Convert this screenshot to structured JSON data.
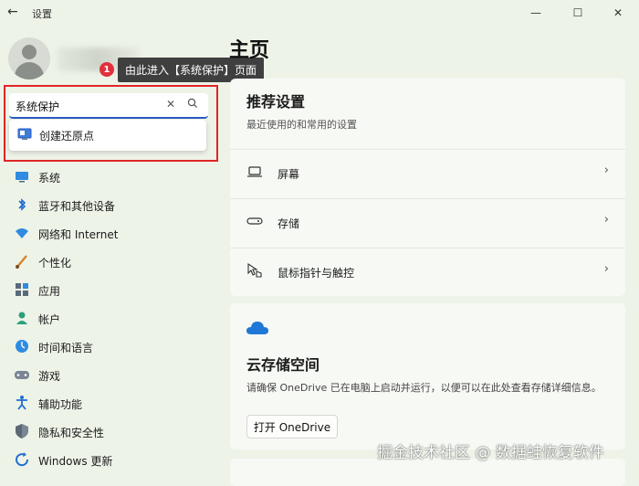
{
  "app": {
    "title": "设置"
  },
  "window_controls": {
    "minimize": "—",
    "maximize": "☐",
    "close": "✕"
  },
  "annotation": {
    "step": "1",
    "text": "由此进入【系统保护】页面"
  },
  "search": {
    "value": "系统保护",
    "clear": "✕",
    "suggestion": "创建还原点"
  },
  "sidebar": {
    "items": [
      {
        "label": "系统",
        "icon": "monitor-icon"
      },
      {
        "label": "蓝牙和其他设备",
        "icon": "bluetooth-icon"
      },
      {
        "label": "网络和 Internet",
        "icon": "wifi-icon"
      },
      {
        "label": "个性化",
        "icon": "brush-icon"
      },
      {
        "label": "应用",
        "icon": "apps-icon"
      },
      {
        "label": "帐户",
        "icon": "account-icon"
      },
      {
        "label": "时间和语言",
        "icon": "globe-clock-icon"
      },
      {
        "label": "游戏",
        "icon": "gamepad-icon"
      },
      {
        "label": "辅助功能",
        "icon": "accessibility-icon"
      },
      {
        "label": "隐私和安全性",
        "icon": "shield-icon"
      },
      {
        "label": "Windows 更新",
        "icon": "update-icon"
      }
    ]
  },
  "main": {
    "title": "主页",
    "recommended": {
      "title": "推荐设置",
      "subtitle": "最近使用的和常用的设置",
      "items": [
        {
          "label": "屏幕",
          "icon": "laptop-icon"
        },
        {
          "label": "存储",
          "icon": "drive-icon"
        },
        {
          "label": "鼠标指针与触控",
          "icon": "pointer-icon"
        }
      ]
    },
    "onedrive": {
      "title": "云存储空间",
      "description": "请确保 OneDrive 已在电脑上启动并运行，以便可以在此处查看存储详细信息。",
      "button": "打开 OneDrive"
    }
  },
  "watermark": "掘金技术社区 @ 数据蛙恢复软件",
  "colors": {
    "accent": "#2a5cc9",
    "highlight_box": "#e02525",
    "badge": "#e1303c"
  }
}
